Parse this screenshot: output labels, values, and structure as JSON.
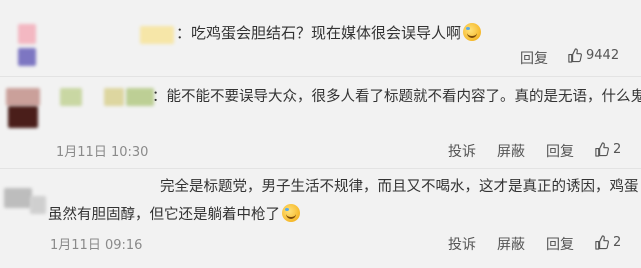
{
  "comments": [
    {
      "text": "：吃鸡蛋会胆结石？现在媒体很会误导人啊",
      "actions": [
        "回复"
      ],
      "likes": "9442",
      "emoji": "laugh-cry-emoji"
    },
    {
      "text": "：能不能不要误导大众，很多人看了标题就不看内容了。真的是无语，什么鬼新",
      "date": "1月11日 10:30",
      "actions": [
        "投诉",
        "屏蔽",
        "回复"
      ],
      "likes": "2"
    },
    {
      "text_line1": "完全是标题党，男子生活不规律，而且又不喝水，这才是真正的诱因，鸡蛋",
      "text_line2": "虽然有胆固醇，但它还是躺着中枪了",
      "date": "1月11日 09:16",
      "actions": [
        "投诉",
        "屏蔽",
        "回复"
      ],
      "likes": "2",
      "emoji": "laugh-cry-emoji"
    }
  ],
  "colors": {
    "background": "#f2f2f2",
    "text": "#333333",
    "meta": "#8a8a8a",
    "divider": "#e3e3e3"
  }
}
